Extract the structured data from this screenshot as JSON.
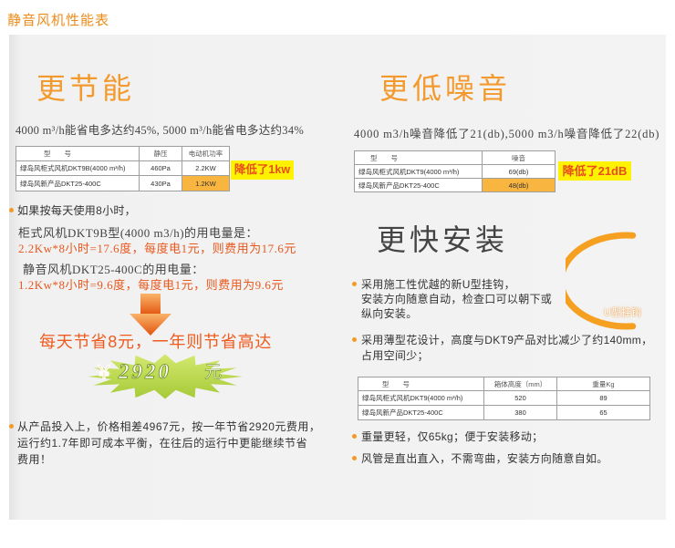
{
  "page_title": "静音风机性能表",
  "colors": {
    "accent": "#f39a2e",
    "accent_red": "#e8591f",
    "highlight": "#f8b53f",
    "badge_bg": "#fff200",
    "star_green": "#b9d84a"
  },
  "icons": [
    "bullet-dot",
    "arrow-down",
    "starburst",
    "u-hook-arc"
  ],
  "energy": {
    "heading": "更节能",
    "summary": "4000 m³/h能省电多达约45%, 5000 m³/h能省电多达约34%",
    "table": {
      "headers": [
        "型　　号",
        "静压",
        "电动机功率"
      ],
      "rows": [
        [
          "绿岛风柜式风机DKT9B(4000 m³/h)",
          "460Pa",
          "2.2KW"
        ],
        [
          "绿岛风新产品DKT25-400C",
          "430Pa",
          "1.2KW"
        ]
      ]
    },
    "badge": "降低了1kw",
    "usage_note": "如果按每天使用8小时，",
    "old_label": "柜式风机DKT9B型(4000 m3/h)的用电量是：",
    "old_calc": "2.2Kw*8小时=17.6度，每度电1元，则费用为17.6元",
    "new_label": "静音风机DKT25-400C的用电量：",
    "new_calc": "1.2Kw*8小时=9.6度，每度电1元，则费用为9.6元",
    "saving_text": "每天节省8元，一年则节省高达",
    "saving_amount": {
      "currency": "￥",
      "value": "2920",
      "unit": "元"
    },
    "roi_lines": [
      "从产品投入上，价格相差4967元，按一年节省2920元费用，",
      "运行约1.7年即可成本平衡，在往后的运行中更能继续节省",
      "费用！"
    ]
  },
  "noise": {
    "heading": "更低噪音",
    "summary": "4000 m3/h噪音降低了21(db),5000 m3/h噪音降低了22(db)",
    "table": {
      "headers": [
        "型　　号",
        "噪音"
      ],
      "rows": [
        [
          "绿岛风柜式风机DKT9(4000 m³/h)",
          "69(db)"
        ],
        [
          "绿岛风新产品DKT25-400C",
          "48(db)"
        ]
      ]
    },
    "badge": "降低了21dB"
  },
  "install": {
    "heading": "更快安装",
    "hook_label": "U型挂钩",
    "hook_lines": [
      "采用施工性优越的新U型挂钩，",
      "安装方向随意自动，检查口可以朝下或",
      "纵向安装。"
    ],
    "slim_lines": [
      "采用薄型花设计，高度与DKT9产品对比减少了约140mm，",
      "占用空间少；"
    ],
    "table": {
      "headers": [
        "型　　号",
        "箱体高度（mm）",
        "重量Kg"
      ],
      "rows": [
        [
          "绿岛风柜式风机DKT9(4000 m³/h)",
          "520",
          "89"
        ],
        [
          "绿岛风新产品DKT25-400C",
          "380",
          "65"
        ]
      ]
    },
    "weight_note": "重量更轻，仅65kg；便于安装移动；",
    "duct_note": "风管是直出直入，不需弯曲，安装方向随意自如。"
  }
}
